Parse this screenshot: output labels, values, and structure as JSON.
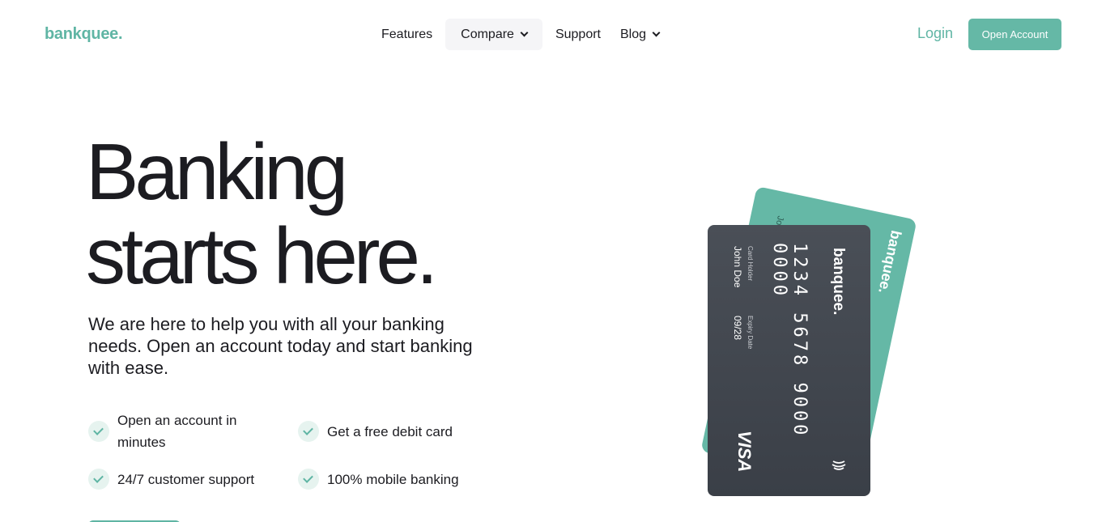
{
  "header": {
    "logo": "bankquee.",
    "nav": [
      {
        "label": "Features",
        "has_dropdown": false
      },
      {
        "label": "Compare",
        "has_dropdown": true
      },
      {
        "label": "Support",
        "has_dropdown": false
      },
      {
        "label": "Blog",
        "has_dropdown": true
      }
    ],
    "login": "Login",
    "open_account": "Open Account"
  },
  "hero": {
    "title_line1": "Banking",
    "title_line2": "starts here.",
    "subtitle": "We are here to help you with all your banking needs. Open an account today and start banking with ease.",
    "features": [
      "Open an account in minutes",
      "Get a free debit card",
      "24/7 customer support",
      "100% mobile banking"
    ]
  },
  "card": {
    "brand": "banquee.",
    "number": "1234 5678 9000 0000",
    "holder_label": "Card Holder",
    "holder": "John Doe",
    "expiry_label": "Expiry Date",
    "expiry": "09/28",
    "network": "VISA"
  },
  "colors": {
    "accent": "#65b8a6",
    "text": "#1c1c21",
    "card_dark": "#3f444c"
  }
}
